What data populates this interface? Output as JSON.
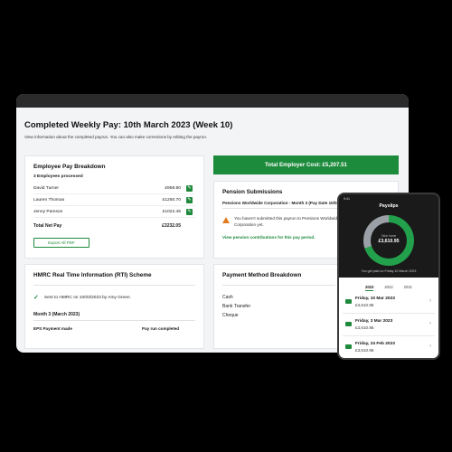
{
  "page": {
    "title": "Completed Weekly Pay: 10th March 2023 (Week 10)",
    "subtitle": "View information about the completed payrun. You can also make corrections by editing the payrun."
  },
  "employee_card": {
    "title": "Employee Pay Breakdown",
    "count": "3 Employees processed",
    "rows": [
      {
        "name": "David Turner",
        "amount": "£958.90"
      },
      {
        "name": "Lauren Thomas",
        "amount": "£1250.70"
      },
      {
        "name": "Jenny Pamson",
        "amount": "£1022.45"
      }
    ],
    "net_label": "Total Net Pay",
    "net_amount": "£3232.05",
    "export_label": "Export All PDF"
  },
  "employer_cost": "Total Employer Cost: £5,207.51",
  "pension_card": {
    "title": "Pension Submissions",
    "line": "Pensions Worldwide Corporation - Month 3 (Pay Date 10/03/",
    "warning": "You haven't submitted this payrun to Pensions Worldwide Corporation yet.",
    "link": "View pension contributions for this pay period."
  },
  "hmrc_card": {
    "title": "HMRC Real Time Information (RTI) Scheme",
    "sent": "Sent to HMRC on 10/03/2023 by Amy Green.",
    "month": "Month 3  (March 2023)",
    "col1": "EPS Payment  made",
    "col2": "Pay run completed"
  },
  "payment_card": {
    "title": "Payment Method Breakdown",
    "methods": [
      "Cash",
      "Bank Transfer",
      "Cheque"
    ]
  },
  "phone": {
    "time": "9:41",
    "title": "Payslips",
    "donut_label": "Take home",
    "donut_value": "£3,610.95",
    "paid_text": "You get paid on Friday 10 March 2023",
    "years": [
      "2023",
      "2022",
      "2021"
    ],
    "active_year": "2023",
    "payslips": [
      {
        "date": "Friday, 10 Mar 2023",
        "amount": "£3,610.95"
      },
      {
        "date": "Friday, 3 Mar 2023",
        "amount": "£3,610.95"
      },
      {
        "date": "Friday, 24 Feb 2023",
        "amount": "£3,610.95"
      }
    ],
    "take_home_fraction": 0.7
  },
  "colors": {
    "accent_green": "#1d8b3c",
    "warning_orange": "#e07b22",
    "background": "#000000"
  }
}
